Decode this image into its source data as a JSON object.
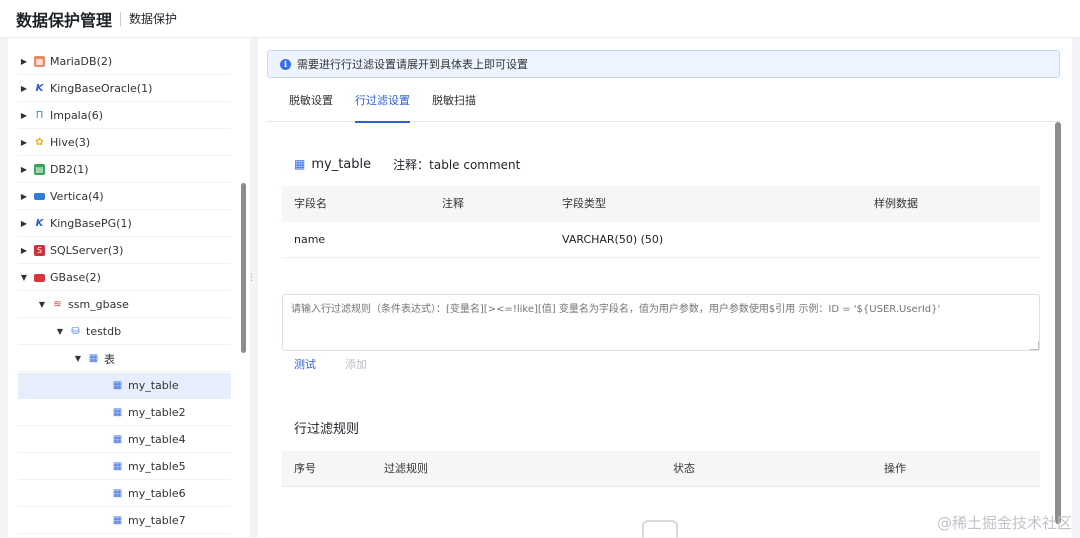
{
  "header": {
    "title": "数据保护管理",
    "subtitle": "数据保护"
  },
  "sidebar": {
    "items": [
      {
        "label": "MariaDB(2)",
        "icon": "mariadb-icon"
      },
      {
        "label": "KingBaseOracle(1)",
        "icon": "kingbase-icon"
      },
      {
        "label": "Impala(6)",
        "icon": "impala-icon"
      },
      {
        "label": "Hive(3)",
        "icon": "hive-icon"
      },
      {
        "label": "DB2(1)",
        "icon": "db2-icon"
      },
      {
        "label": "Vertica(4)",
        "icon": "vertica-icon"
      },
      {
        "label": "KingBasePG(1)",
        "icon": "kingbase-icon"
      },
      {
        "label": "SQLServer(3)",
        "icon": "sqlserver-icon"
      },
      {
        "label": "GBase(2)",
        "icon": "gbase-icon"
      },
      {
        "label": "ssm_gbase",
        "icon": "database-icon"
      },
      {
        "label": "testdb",
        "icon": "schema-icon"
      },
      {
        "label": "表",
        "icon": "table-folder-icon"
      },
      {
        "label": "my_table",
        "icon": "table-icon"
      },
      {
        "label": "my_table2",
        "icon": "table-icon"
      },
      {
        "label": "my_table4",
        "icon": "table-icon"
      },
      {
        "label": "my_table5",
        "icon": "table-icon"
      },
      {
        "label": "my_table6",
        "icon": "table-icon"
      },
      {
        "label": "my_table7",
        "icon": "table-icon"
      }
    ]
  },
  "alert": {
    "text": "需要进行行过滤设置请展开到具体表上即可设置"
  },
  "tabs": [
    {
      "label": "脱敏设置"
    },
    {
      "label": "行过滤设置"
    },
    {
      "label": "脱敏扫描"
    }
  ],
  "table_info": {
    "name": "my_table",
    "comment": "注释：table comment"
  },
  "field_table": {
    "headers": [
      "字段名",
      "注释",
      "字段类型",
      "样例数据"
    ],
    "rows": [
      {
        "name": "name",
        "comment": "",
        "type": "VARCHAR(50) (50)",
        "sample": ""
      }
    ]
  },
  "rule_input": {
    "placeholder": "请输入行过滤规则（条件表达式）：[变量名][><=!like][值] 变量名为字段名，值为用户参数，用户参数使用$引用 示例：ID = '${USER.UserId}'"
  },
  "actions": {
    "test": "测试",
    "add": "添加"
  },
  "rules_section": {
    "title": "行过滤规则",
    "headers": [
      "序号",
      "过滤规则",
      "状态",
      "操作"
    ]
  },
  "watermark": "@稀土掘金技术社区",
  "colors": {
    "accent": "#2f5fd0",
    "selected_bg": "#e6edfb",
    "alert_bg": "#eef4ff"
  }
}
